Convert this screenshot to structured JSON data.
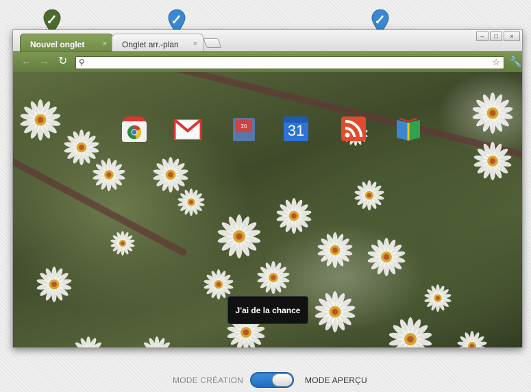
{
  "tabs": [
    {
      "label": "Nouvel onglet",
      "close": "×"
    },
    {
      "label": "Onglet arr.-plan",
      "close": "×"
    }
  ],
  "window_controls": {
    "minimize": "–",
    "maximize": "□",
    "close": "×"
  },
  "toolbar": {
    "back": "←",
    "forward": "→",
    "reload": "↻",
    "omnibox_value": "",
    "search_icon": "⚲",
    "star": "☆",
    "wrench": "🔧"
  },
  "apps": [
    {
      "name": "Chrome Web Store"
    },
    {
      "name": "Gmail"
    },
    {
      "name": "Address book"
    },
    {
      "name": "Calendar",
      "day": "31"
    },
    {
      "name": "Reader"
    },
    {
      "name": "Books"
    }
  ],
  "lucky_button": "J'ai de la chance",
  "mode": {
    "left_label": "MODE CRÉATION",
    "right_label": "MODE APERÇU",
    "toggle_state": "on"
  },
  "colors": {
    "active_tab": "#7c9652",
    "pin_green": "#4d6a2f",
    "pin_blue": "#3c87d1",
    "toggle_blue": "#2c7bd3",
    "label_grey": "#8a8a8a",
    "label_dark": "#333333"
  }
}
